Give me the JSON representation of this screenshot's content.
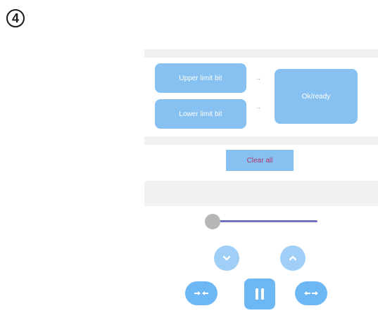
{
  "step": {
    "number": "4"
  },
  "limits": {
    "upper_label": "Upper limit bit",
    "lower_label": "Lower limit bit",
    "arrow_glyph": "→"
  },
  "status": {
    "label": "Ok/ready"
  },
  "actions": {
    "clear_label": "Clear all"
  },
  "slider": {
    "value": 0
  },
  "controls": {
    "down_icon": "chevron-down-icon",
    "up_icon": "chevron-up-icon",
    "shrink_icon": "arrows-inward-icon",
    "pause_icon": "pause-icon",
    "expand_icon": "arrows-outward-icon"
  },
  "colors": {
    "button_blue": "#86c1f2",
    "control_blue": "#6cb7f4",
    "clear_text": "#b0346a",
    "slider_track": "#6f73c0",
    "slider_thumb": "#b6b6b6"
  }
}
